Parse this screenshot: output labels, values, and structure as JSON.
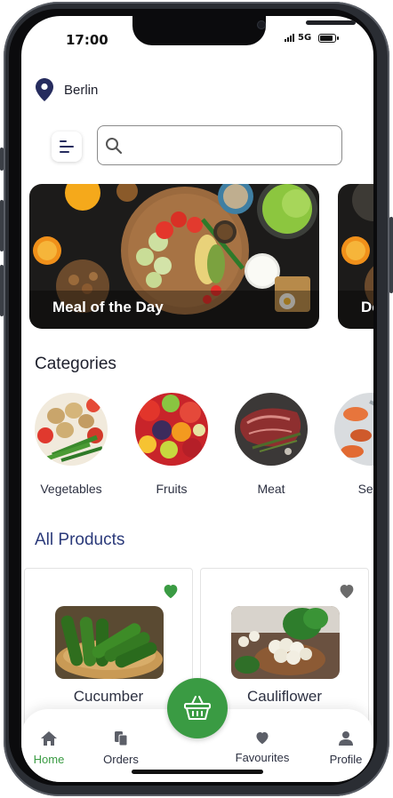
{
  "status_bar": {
    "time": "17:00",
    "network": "5G"
  },
  "location": {
    "city": "Berlin",
    "icon": "location-pin-icon"
  },
  "search": {
    "placeholder": ""
  },
  "banners": [
    {
      "label": "Meal of the Day"
    },
    {
      "label": "De"
    }
  ],
  "categories": {
    "title": "Categories",
    "items": [
      {
        "label": "Vegetables"
      },
      {
        "label": "Fruits"
      },
      {
        "label": "Meat"
      },
      {
        "label": "Seaf"
      }
    ]
  },
  "products": {
    "title": "All Products",
    "items": [
      {
        "name": "Cucumber",
        "favourite": true
      },
      {
        "name": "Cauliflower",
        "favourite": false
      }
    ]
  },
  "bottom_nav": {
    "items": [
      {
        "label": "Home",
        "icon": "home-icon",
        "active": true
      },
      {
        "label": "Orders",
        "icon": "orders-icon",
        "active": false
      },
      {
        "label": "Favourites",
        "icon": "heart-icon",
        "active": false
      },
      {
        "label": "Profile",
        "icon": "profile-icon",
        "active": false
      }
    ],
    "center_button_icon": "basket-icon"
  },
  "colors": {
    "accent": "#3a9b43",
    "heading": "#1d1f2c",
    "section_blue": "#2b3a7a",
    "text": "#2d3142",
    "heart_inactive": "#6b6b6b"
  }
}
